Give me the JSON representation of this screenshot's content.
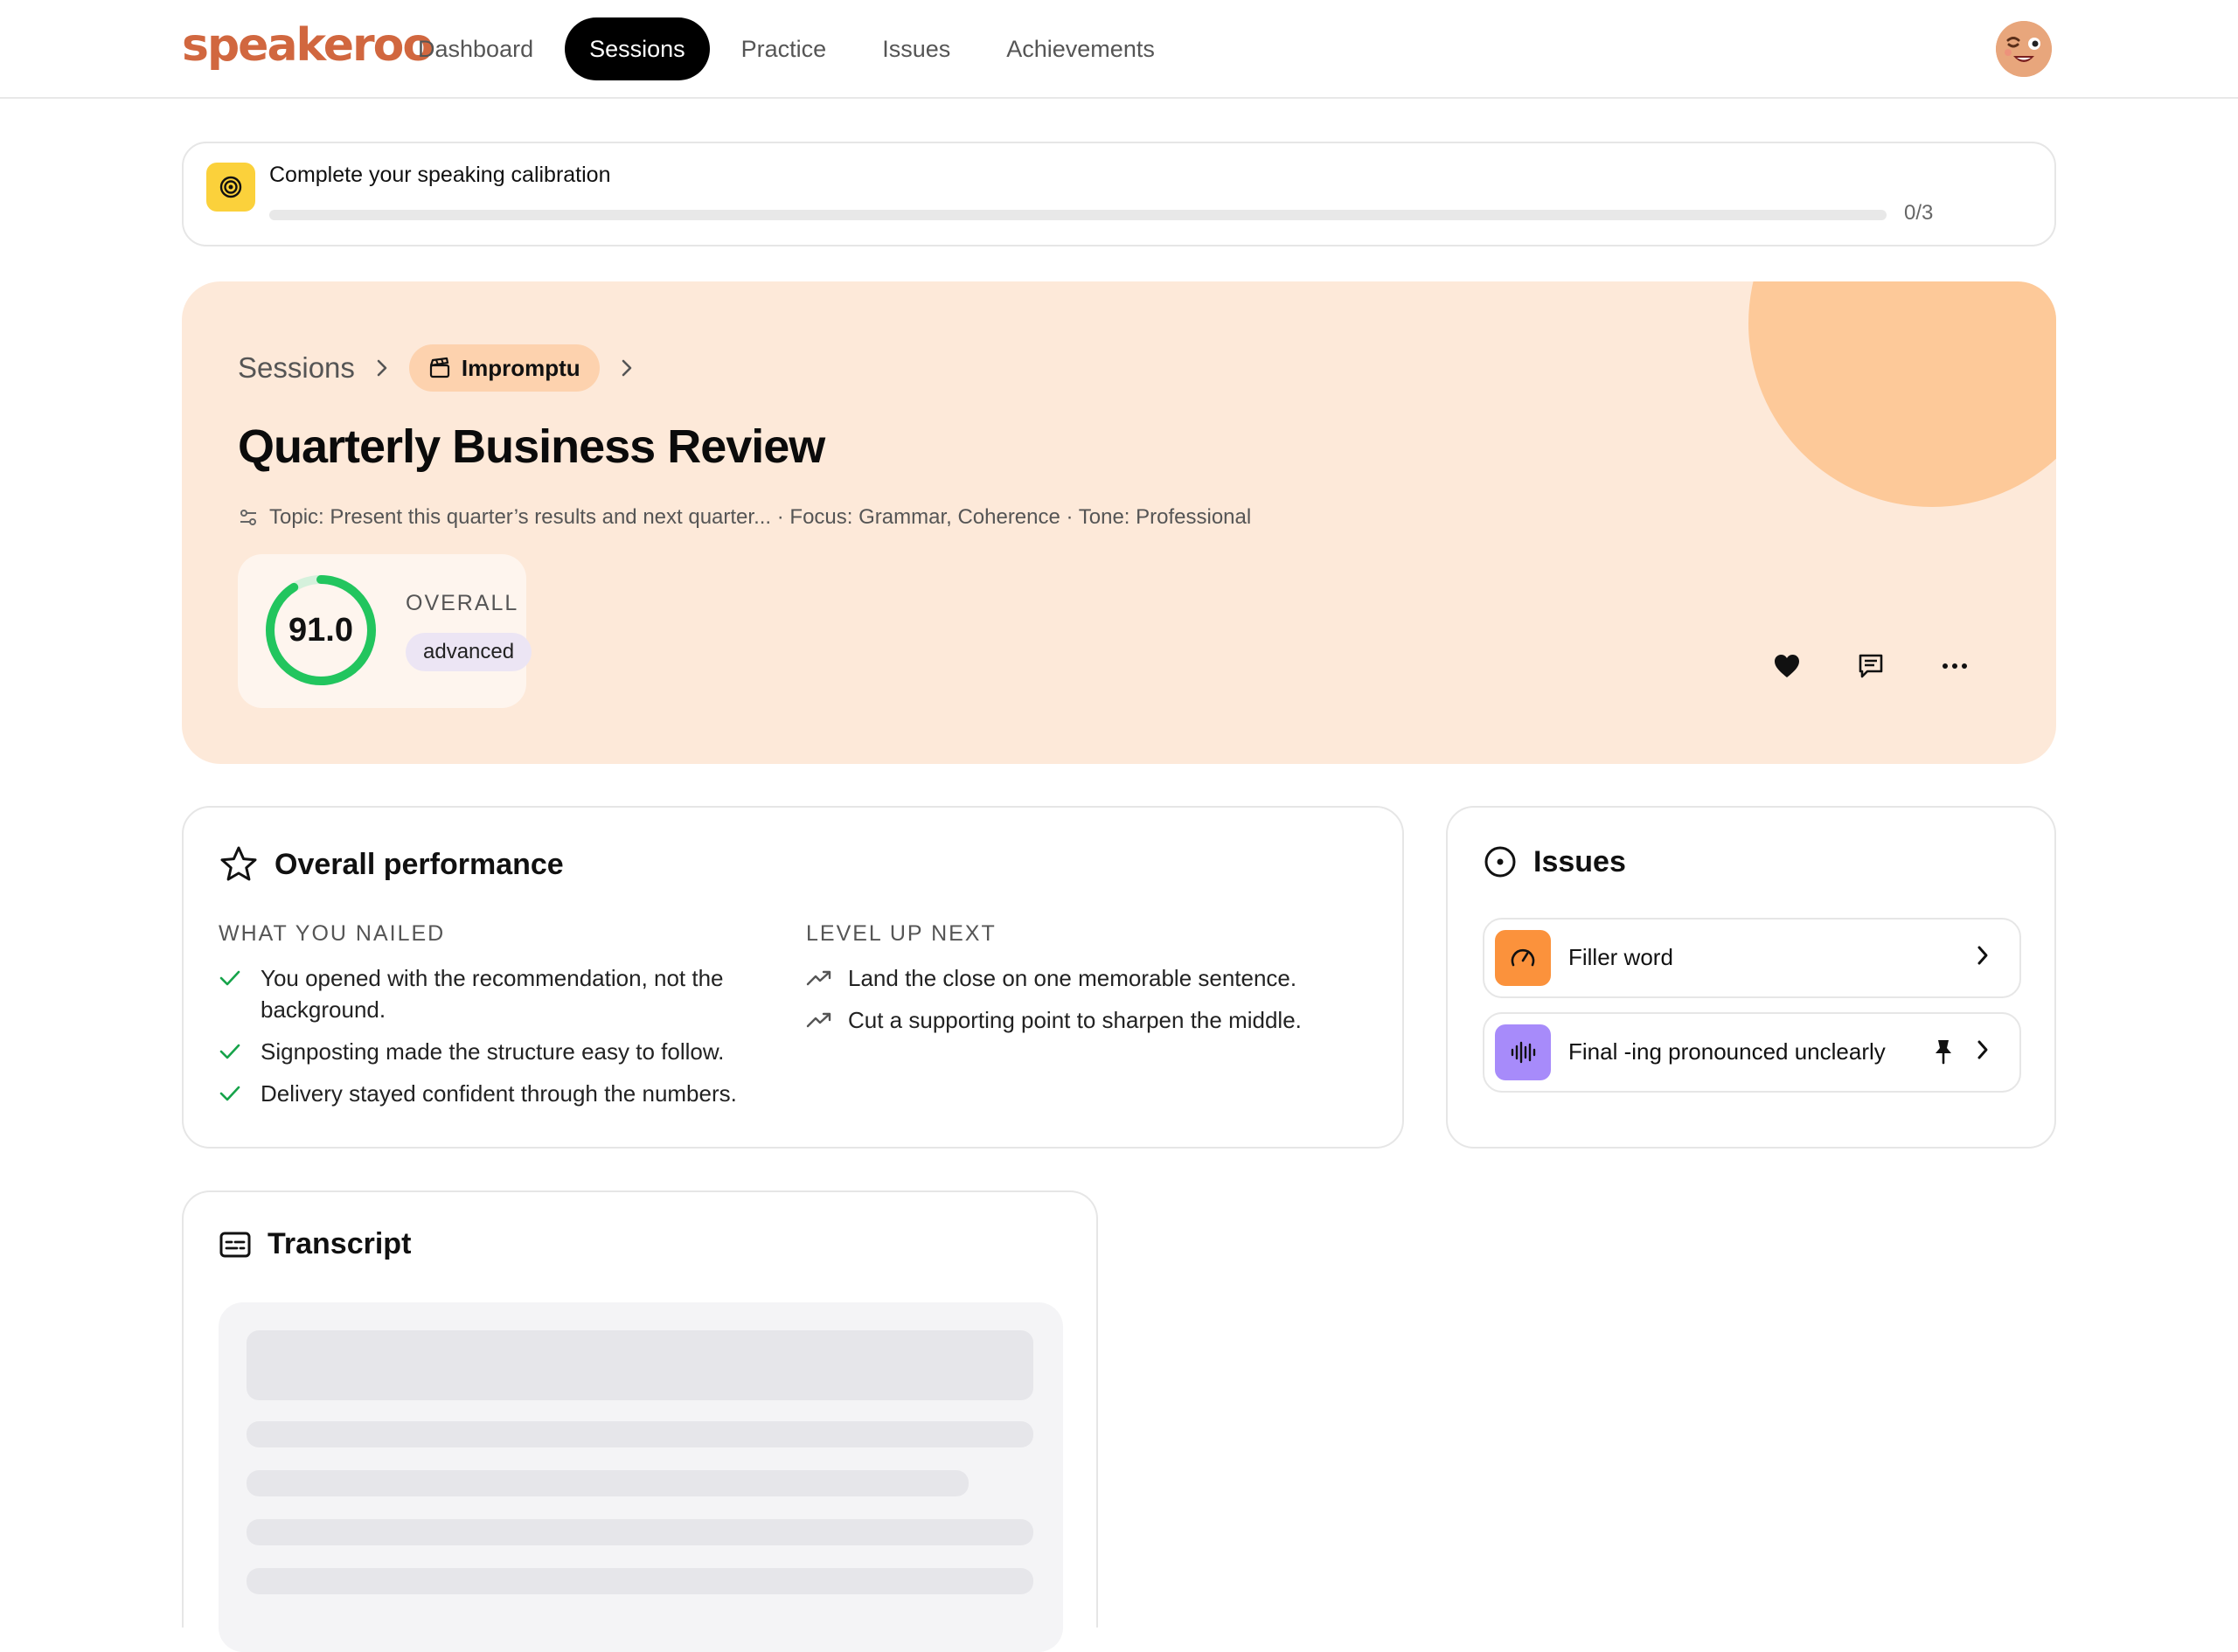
{
  "app": {
    "logo": "speakeroo"
  },
  "nav": {
    "items": [
      {
        "label": "Dashboard",
        "active": false
      },
      {
        "label": "Sessions",
        "active": true
      },
      {
        "label": "Practice",
        "active": false
      },
      {
        "label": "Issues",
        "active": false
      },
      {
        "label": "Achievements",
        "active": false
      }
    ],
    "avatar_icon": "smiling-face-avatar"
  },
  "calibration": {
    "title": "Complete your speaking calibration",
    "progress": 0,
    "count": "0/3",
    "icon": "target-icon",
    "accent": "#fbd13b"
  },
  "hero": {
    "breadcrumb_root": "Sessions",
    "session_type": "Impromptu",
    "title": "Quarterly Business Review",
    "meta": "Topic: Present this quarter’s results and next quarter... · Focus: Grammar, Coherence · Tone: Professional",
    "score": "91.0",
    "score_fraction": 0.91,
    "score_label": "OVERALL",
    "level": "advanced",
    "colors": {
      "background": "#fde9d9",
      "accent": "#fdc999",
      "ring": "#22c55e"
    },
    "actions": [
      "heart-icon",
      "comment-icon",
      "more-icon"
    ]
  },
  "performance": {
    "title": "Overall performance",
    "nailed": {
      "heading": "WHAT YOU NAILED",
      "items": [
        "You opened with the recommendation, not the background.",
        "Signposting made the structure easy to follow.",
        "Delivery stayed confident through the numbers."
      ]
    },
    "level_up": {
      "heading": "LEVEL UP NEXT",
      "items": [
        "Land the close on one memorable sentence.",
        "Cut a supporting point to sharpen the middle."
      ]
    }
  },
  "issues": {
    "title": "Issues",
    "items": [
      {
        "label": "Filler word",
        "icon": "gauge-icon",
        "color": "#fb923c",
        "pinned": false
      },
      {
        "label": "Final -ing pronounced unclearly",
        "icon": "waveform-icon",
        "color": "#a78bfa",
        "pinned": true
      }
    ]
  },
  "transcript": {
    "title": "Transcript"
  }
}
